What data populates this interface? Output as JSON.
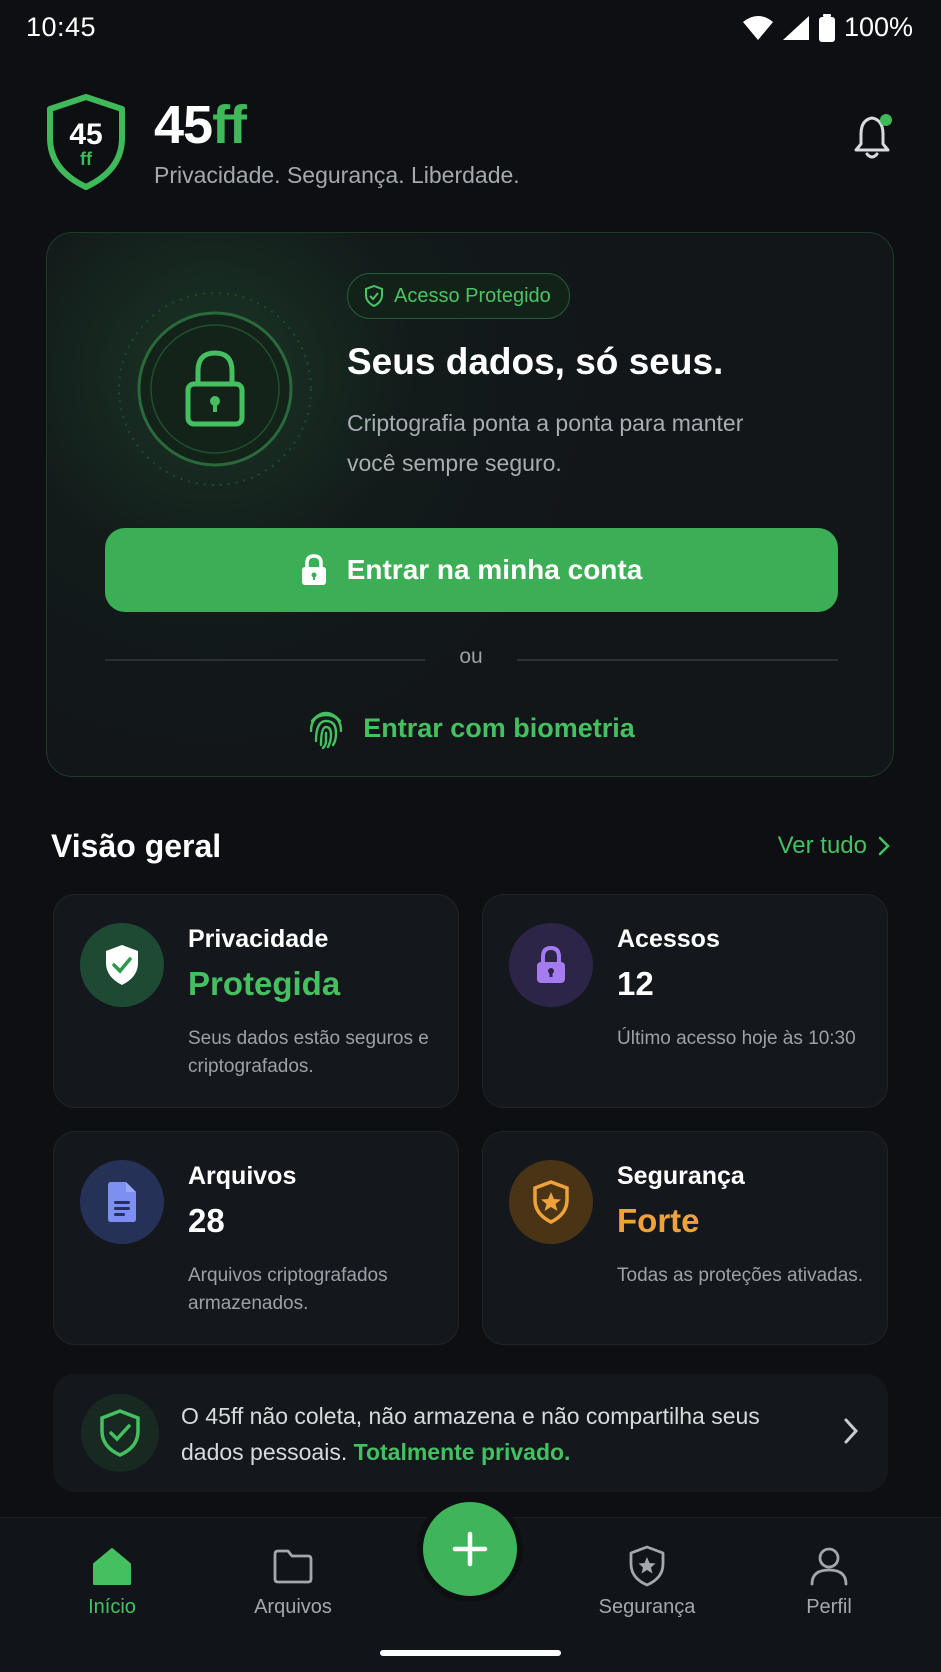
{
  "status_bar": {
    "time": "10:45",
    "battery": "100%"
  },
  "header": {
    "logo_number": "45",
    "logo_suffix": "ff",
    "app_name_main": "45",
    "app_name_accent": "ff",
    "tagline": "Privacidade. Segurança. Liberdade."
  },
  "hero": {
    "badge": "Acesso Protegido",
    "title": "Seus dados, só seus.",
    "description": "Criptografia ponta a ponta para manter você sempre seguro.",
    "login_button": "Entrar na minha conta",
    "divider": "ou",
    "biometric_button": "Entrar com biometria"
  },
  "overview": {
    "title": "Visão geral",
    "see_all": "Ver tudo",
    "cards": [
      {
        "title": "Privacidade",
        "value": "Protegida",
        "desc": "Seus dados estão seguros e criptografados.",
        "icon": "shield-check-icon",
        "color": "#45c061"
      },
      {
        "title": "Acessos",
        "value": "12",
        "desc": "Último acesso hoje às 10:30",
        "icon": "lock-icon",
        "color": "#ffffff"
      },
      {
        "title": "Arquivos",
        "value": "28",
        "desc": "Arquivos criptografados armazenados.",
        "icon": "document-icon",
        "color": "#ffffff"
      },
      {
        "title": "Segurança",
        "value": "Forte",
        "desc": "Todas as proteções ativadas.",
        "icon": "shield-star-icon",
        "color": "#f0a23a"
      }
    ]
  },
  "banner": {
    "text": "O 45ff não coleta, não armazena e não compartilha seus dados pessoais. ",
    "highlight": "Totalmente privado."
  },
  "nav": {
    "items": [
      {
        "label": "Início",
        "icon": "home-icon",
        "active": true
      },
      {
        "label": "Arquivos",
        "icon": "folder-icon",
        "active": false
      },
      {
        "label": "Segurança",
        "icon": "shield-star-icon",
        "active": false
      },
      {
        "label": "Perfil",
        "icon": "user-icon",
        "active": false
      }
    ],
    "fab_icon": "plus-icon"
  },
  "colors": {
    "accent": "#3fb95a",
    "background": "#0d0f12",
    "card": "#14181d",
    "warning": "#f0a23a",
    "purple": "#a57cf0",
    "blue": "#7d8ff0"
  }
}
